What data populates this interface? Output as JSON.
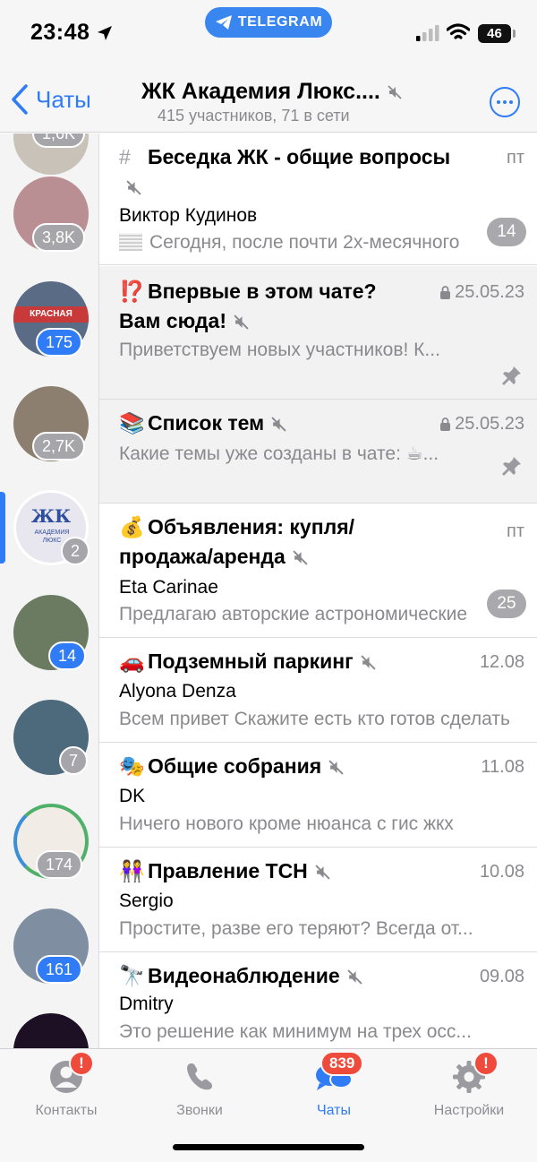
{
  "status_bar": {
    "time": "23:48",
    "app_pill": "TELEGRAM",
    "battery": "46"
  },
  "header": {
    "back_label": "Чаты",
    "title": "ЖК Академия Люкс....",
    "subtitle": "415 участников, 71 в сети"
  },
  "sidebar": {
    "items": [
      {
        "badge": "1,6K",
        "kind": "muted",
        "color": "#c9c2b8"
      },
      {
        "badge": "3,8K",
        "kind": "muted",
        "color": "#b98f93"
      },
      {
        "badge": "175",
        "kind": "active",
        "color": "#5a6b86"
      },
      {
        "badge": "2,7K",
        "kind": "muted",
        "color": "#8d7f6f"
      },
      {
        "badge": "2",
        "kind": "muted",
        "color": "#e8e6ee"
      },
      {
        "badge": "14",
        "kind": "active",
        "color": "#6b7b62"
      },
      {
        "badge": "7",
        "kind": "muted",
        "color": "#4d6a7c"
      },
      {
        "badge": "174",
        "kind": "muted",
        "color": "#f1ede6"
      },
      {
        "badge": "161",
        "kind": "active",
        "color": "#7f8ea1"
      },
      {
        "badge": "",
        "kind": "none",
        "color": "#1d1025"
      }
    ],
    "logo_text": "ЖК",
    "logo_subtext": "АКАДЕМИЯ ЛЮКС"
  },
  "topics": [
    {
      "icon": "#",
      "title": "Беседка ЖК - общие вопросы",
      "date": "пт",
      "author": "Виктор Кудинов",
      "message": "Сегодня, после почти 2х-месячного",
      "unread": "14",
      "pinned": false,
      "locked": false
    },
    {
      "icon": "⁉️",
      "title": "Впервые в этом чате? Вам сюда!",
      "date": "25.05.23",
      "author": "",
      "message": "Приветствуем новых участников! К...",
      "unread": "",
      "pinned": true,
      "locked": true
    },
    {
      "icon": "📚",
      "title": "Список тем",
      "date": "25.05.23",
      "author": "",
      "message": "Какие темы уже созданы в чате: ☕...",
      "unread": "",
      "pinned": true,
      "locked": true
    },
    {
      "icon": "💰",
      "title": "Объявления: купля/продажа/аренда",
      "date": "пт",
      "author": "Eta Carinae",
      "message": "Предлагаю авторские астрономические",
      "unread": "25",
      "pinned": false,
      "locked": false
    },
    {
      "icon": "🚗",
      "title": "Подземный паркинг",
      "date": "12.08",
      "author": "Alyona Denza",
      "message": "Всем привет Скажите есть кто готов сделать",
      "unread": "",
      "pinned": false,
      "locked": false
    },
    {
      "icon": "🎭",
      "title": "Общие собрания",
      "date": "11.08",
      "author": "DK",
      "message": "Ничего нового кроме нюанса с гис жкх",
      "unread": "",
      "pinned": false,
      "locked": false
    },
    {
      "icon": "👭",
      "title": "Правление ТСН",
      "date": "10.08",
      "author": "Sergio",
      "message": "Простите, разве его теряют? Всегда от...",
      "unread": "",
      "pinned": false,
      "locked": false
    },
    {
      "icon": "🔭",
      "title": "Видеонаблюдение",
      "date": "09.08",
      "author": "Dmitry",
      "message": "Это решение как минимум на трех осс...",
      "unread": "",
      "pinned": false,
      "locked": false
    }
  ],
  "tabs": [
    {
      "label": "Контакты",
      "icon": "person-icon",
      "badge": "!",
      "active": false
    },
    {
      "label": "Звонки",
      "icon": "phone-icon",
      "badge": "",
      "active": false
    },
    {
      "label": "Чаты",
      "icon": "chat-bubbles-icon",
      "badge": "839",
      "active": true
    },
    {
      "label": "Настройки",
      "icon": "gear-icon",
      "badge": "!",
      "active": false
    }
  ],
  "colors": {
    "accent": "#2f7cf6",
    "badge_red": "#ef4b3c",
    "muted_badge": "#a8a8ad"
  }
}
